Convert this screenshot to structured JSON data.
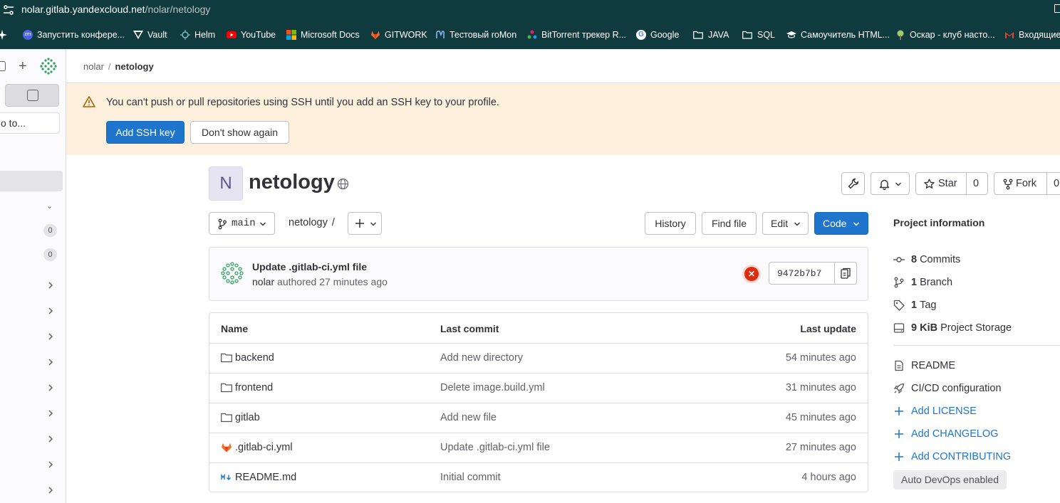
{
  "browser": {
    "url_host": "nolar.gitlab.yandexcloud.net",
    "url_path": "/nolar/netology",
    "bookmarks": [
      {
        "label": "Запустить конфере...",
        "icon": "zoom-icon"
      },
      {
        "label": "Vault",
        "icon": "vault-icon"
      },
      {
        "label": "Helm",
        "icon": "helm-icon"
      },
      {
        "label": "YouTube",
        "icon": "youtube-icon"
      },
      {
        "label": "Microsoft Docs",
        "icon": "microsoft-icon"
      },
      {
        "label": "GITWORK",
        "icon": "gitlab-icon"
      },
      {
        "label": "Тестовый roMon",
        "icon": "romon-icon"
      },
      {
        "label": "BitTorrent трекер R...",
        "icon": "torrent-icon"
      },
      {
        "label": "Google",
        "icon": "google-icon"
      },
      {
        "label": "JAVA",
        "icon": "folder-icon"
      },
      {
        "label": "SQL",
        "icon": "folder-icon"
      },
      {
        "label": "Самоучитель HTML...",
        "icon": "hat-icon"
      },
      {
        "label": "Оскар - клуб насто...",
        "icon": "tree-icon"
      },
      {
        "label": "Входящие",
        "icon": "gmail-icon"
      }
    ]
  },
  "sidebar": {
    "search_text": "o to...",
    "counts": [
      "0",
      "0"
    ]
  },
  "breadcrumb": {
    "parent": "nolar",
    "separator": "/",
    "current": "netology"
  },
  "alert": {
    "message": "You can't push or pull repositories using SSH until you add an SSH key to your profile.",
    "primary_label": "Add SSH key",
    "secondary_label": "Don't show again"
  },
  "project": {
    "avatar_letter": "N",
    "name": "netology",
    "star_label": "Star",
    "star_count": "0",
    "fork_label": "Fork",
    "fork_count": "0"
  },
  "toolbar": {
    "branch": "main",
    "path_root": "netology",
    "path_sep": "/",
    "history_label": "History",
    "find_file_label": "Find file",
    "edit_label": "Edit",
    "code_label": "Code"
  },
  "last_commit": {
    "title": "Update .gitlab-ci.yml file",
    "author": "nolar",
    "meta": "authored 27 minutes ago",
    "pipeline_status": "failed",
    "sha": "9472b7b7"
  },
  "files": {
    "headers": {
      "name": "Name",
      "last_commit": "Last commit",
      "last_update": "Last update"
    },
    "rows": [
      {
        "name": "backend",
        "type": "folder",
        "commit": "Add new directory",
        "updated": "54 minutes ago"
      },
      {
        "name": "frontend",
        "type": "folder",
        "commit": "Delete image.build.yml",
        "updated": "31 minutes ago"
      },
      {
        "name": "gitlab",
        "type": "folder",
        "commit": "Add new file",
        "updated": "45 minutes ago"
      },
      {
        "name": ".gitlab-ci.yml",
        "type": "gitlab-file",
        "commit": "Update .gitlab-ci.yml file",
        "updated": "27 minutes ago"
      },
      {
        "name": "README.md",
        "type": "markdown",
        "commit": "Initial commit",
        "updated": "4 hours ago"
      }
    ]
  },
  "project_info": {
    "title": "Project information",
    "commits_count": "8",
    "commits_label": "Commits",
    "branch_count": "1",
    "branch_label": "Branch",
    "tag_count": "1",
    "tag_label": "Tag",
    "storage_size": "9 KiB",
    "storage_label": "Project Storage",
    "readme_label": "README",
    "cicd_label": "CI/CD configuration",
    "add_license": "Add LICENSE",
    "add_changelog": "Add CHANGELOG",
    "add_contributing": "Add CONTRIBUTING",
    "auto_devops": "Auto DevOps enabled"
  },
  "colors": {
    "primary": "#1f75cb",
    "alert_bg": "#fdf1dd",
    "browser_bar": "#0f3b3f",
    "status_failed": "#dd2b0e"
  }
}
